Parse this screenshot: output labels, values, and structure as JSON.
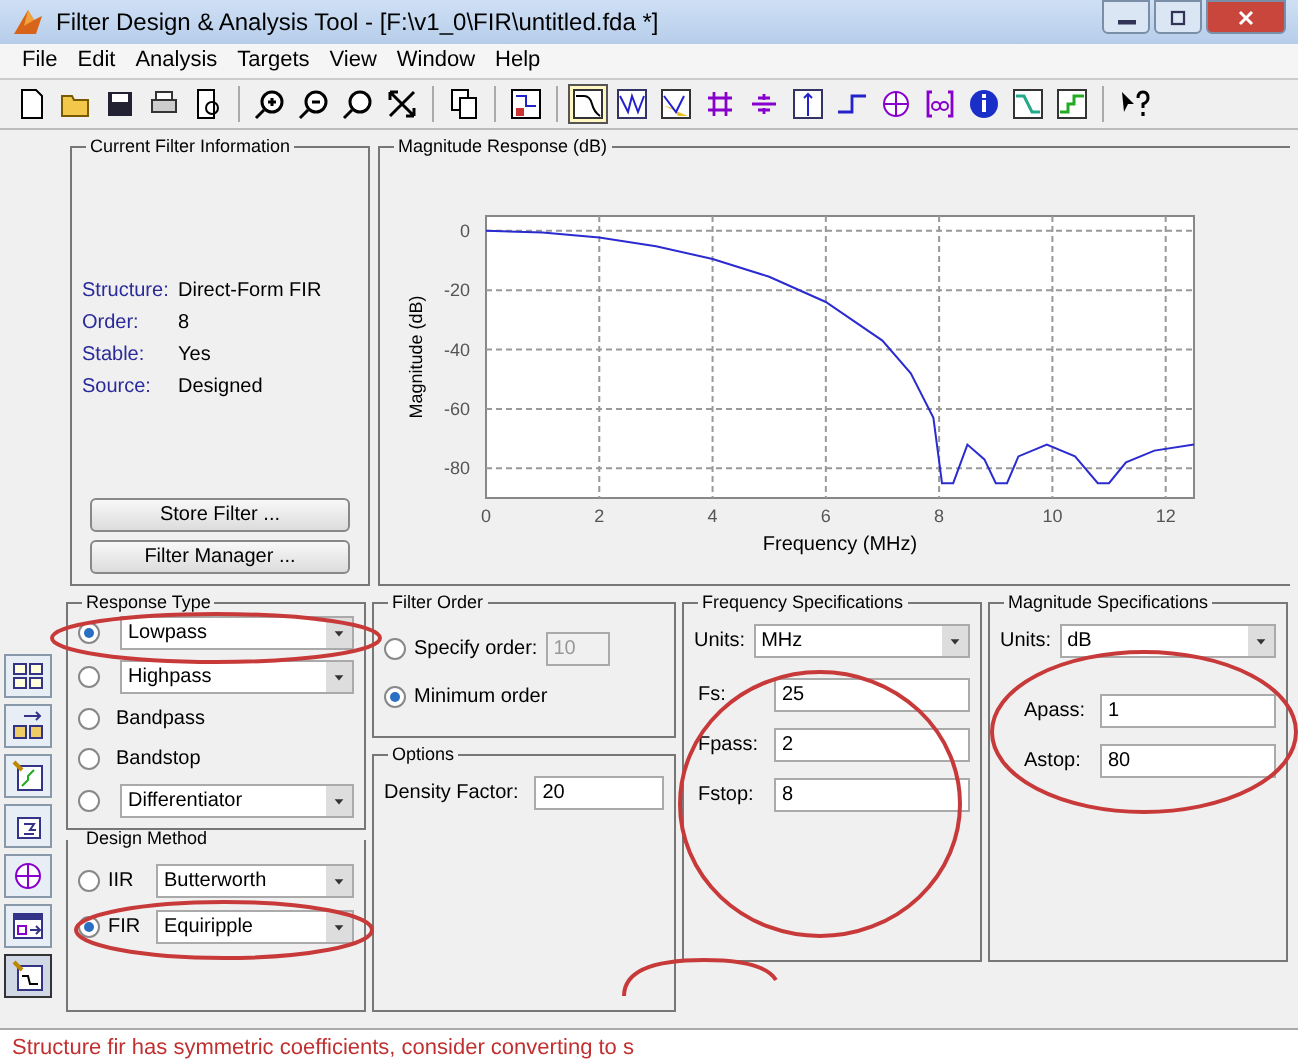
{
  "window": {
    "title": "Filter Design & Analysis Tool -  [F:\\v1_0\\FIR\\untitled.fda *]"
  },
  "menu": [
    "File",
    "Edit",
    "Analysis",
    "Targets",
    "View",
    "Window",
    "Help"
  ],
  "toolbar": [
    {
      "kind": "new",
      "selected": false
    },
    {
      "kind": "open",
      "selected": false
    },
    {
      "kind": "save",
      "selected": false
    },
    {
      "kind": "print",
      "selected": false
    },
    {
      "kind": "preview",
      "selected": false
    },
    {
      "kind": "sep"
    },
    {
      "kind": "zoom-in",
      "selected": false
    },
    {
      "kind": "zoom-out",
      "selected": false
    },
    {
      "kind": "zoom-x",
      "selected": false
    },
    {
      "kind": "fit",
      "selected": false
    },
    {
      "kind": "sep"
    },
    {
      "kind": "copy",
      "selected": false
    },
    {
      "kind": "sep"
    },
    {
      "kind": "specs",
      "selected": false
    },
    {
      "kind": "sep"
    },
    {
      "kind": "magnitude",
      "selected": true
    },
    {
      "kind": "phase",
      "selected": false
    },
    {
      "kind": "magphase",
      "selected": false
    },
    {
      "kind": "group-delay",
      "selected": false
    },
    {
      "kind": "phase-delay",
      "selected": false
    },
    {
      "kind": "impulse",
      "selected": false
    },
    {
      "kind": "step",
      "selected": false
    },
    {
      "kind": "pole-zero",
      "selected": false
    },
    {
      "kind": "coeffs",
      "selected": false
    },
    {
      "kind": "info",
      "selected": false
    },
    {
      "kind": "response",
      "selected": false
    },
    {
      "kind": "noise",
      "selected": false
    },
    {
      "kind": "sep"
    },
    {
      "kind": "help",
      "selected": false
    }
  ],
  "filter_info": {
    "title": "Current Filter Information",
    "rows": [
      {
        "label": "Structure:",
        "value": "Direct-Form FIR"
      },
      {
        "label": "Order:",
        "value": "8"
      },
      {
        "label": "Stable:",
        "value": "Yes"
      },
      {
        "label": "Source:",
        "value": "Designed"
      }
    ],
    "buttons": [
      "Store Filter ...",
      "Filter Manager ..."
    ]
  },
  "magnitude_response": {
    "title": "Magnitude Response (dB)",
    "chart_data": {
      "type": "line",
      "xlabel": "Frequency (MHz)",
      "ylabel": "Magnitude (dB)",
      "x": [
        0,
        1,
        2,
        3,
        4,
        5,
        6,
        7,
        7.5,
        7.9,
        8.05,
        8.25,
        8.5,
        8.8,
        9.0,
        9.2,
        9.4,
        9.9,
        10.4,
        10.8,
        11.0,
        11.3,
        11.8,
        12.5
      ],
      "grid": true,
      "series": [
        {
          "color": "#2b2bd0",
          "values": [
            0,
            -0.6,
            -2.2,
            -5.2,
            -9.5,
            -15.5,
            -24,
            -37,
            -48,
            -63,
            -85,
            -85,
            -72,
            -77,
            -85,
            -85,
            -76,
            -72,
            -76,
            -85,
            -85,
            -78,
            -74,
            -72
          ]
        }
      ],
      "xlim": [
        0,
        12.5
      ],
      "ylim": [
        -90,
        5
      ],
      "xticks": [
        0,
        2,
        4,
        6,
        8,
        10,
        12
      ],
      "yticks": [
        0,
        -20,
        -40,
        -60,
        -80
      ]
    }
  },
  "side_tools": [
    {
      "kind": "transform",
      "selected": false
    },
    {
      "kind": "convert",
      "selected": false
    },
    {
      "kind": "quantize",
      "selected": false
    },
    {
      "kind": "realize",
      "selected": false
    },
    {
      "kind": "pole-zero",
      "selected": false
    },
    {
      "kind": "import",
      "selected": false
    },
    {
      "kind": "design",
      "selected": true
    }
  ],
  "response_type": {
    "title": "Response Type",
    "options": [
      {
        "label": "Lowpass",
        "kind": "dropdown",
        "selected": true
      },
      {
        "label": "Highpass",
        "kind": "dropdown",
        "selected": false
      },
      {
        "label": "Bandpass",
        "kind": "plain",
        "selected": false
      },
      {
        "label": "Bandstop",
        "kind": "plain",
        "selected": false
      },
      {
        "label": "Differentiator",
        "kind": "dropdown",
        "selected": false
      }
    ]
  },
  "design_method": {
    "title": "Design Method",
    "options": [
      {
        "label": "IIR",
        "dropdown": "Butterworth",
        "selected": false
      },
      {
        "label": "FIR",
        "dropdown": "Equiripple",
        "selected": true
      }
    ]
  },
  "filter_order": {
    "title": "Filter Order",
    "options": [
      {
        "label": "Specify order:",
        "value": "10",
        "selected": false
      },
      {
        "label": "Minimum order",
        "selected": true
      }
    ]
  },
  "options": {
    "title": "Options",
    "fields": [
      {
        "label": "Density Factor:",
        "value": "20"
      }
    ]
  },
  "frequency_specifications": {
    "title": "Frequency Specifications",
    "units": {
      "label": "Units:",
      "value": "MHz"
    },
    "fields": [
      {
        "label": "Fs:",
        "value": "25"
      },
      {
        "label": "Fpass:",
        "value": "2"
      },
      {
        "label": "Fstop:",
        "value": "8"
      }
    ]
  },
  "magnitude_specifications": {
    "title": "Magnitude Specifications",
    "units": {
      "label": "Units:",
      "value": "dB"
    },
    "fields": [
      {
        "label": "Apass:",
        "value": "1"
      },
      {
        "label": "Astop:",
        "value": "80"
      }
    ]
  },
  "status_bar": "Structure fir has symmetric coefficients, consider converting to s"
}
